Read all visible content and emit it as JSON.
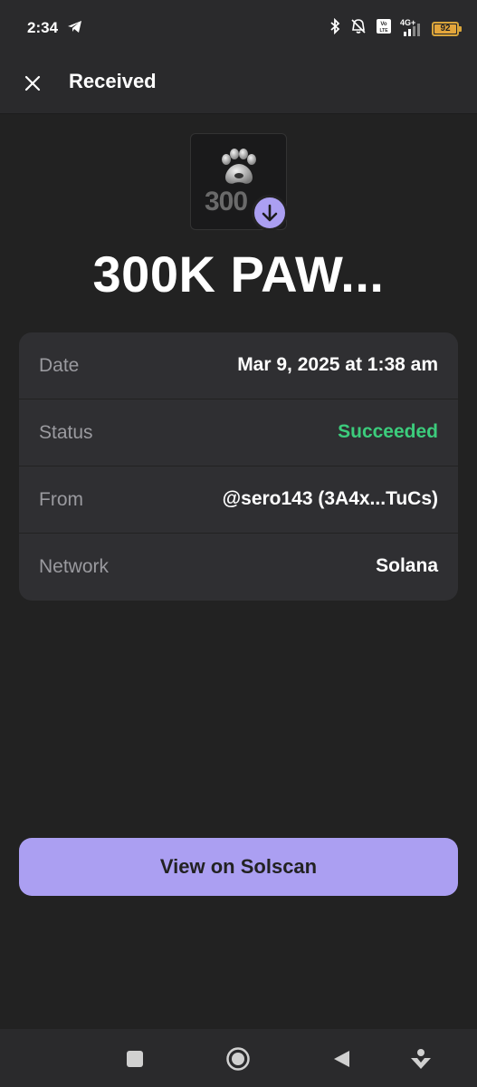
{
  "status_bar": {
    "time": "2:34",
    "battery": "92",
    "network": "4G+",
    "icons": [
      "telegram-icon",
      "bluetooth-icon",
      "mute-icon",
      "volte-icon",
      "signal-icon",
      "battery-icon"
    ]
  },
  "header": {
    "title": "Received",
    "close_icon": "close-icon"
  },
  "token": {
    "image_text": "300",
    "name": "300K PAW...",
    "badge_icon": "arrow-down-icon"
  },
  "details": [
    {
      "label": "Date",
      "value": "Mar 9, 2025 at 1:38 am"
    },
    {
      "label": "Status",
      "value": "Succeeded"
    },
    {
      "label": "From",
      "value": "@sero143 (3A4x...TuCs)"
    },
    {
      "label": "Network",
      "value": "Solana"
    }
  ],
  "actions": {
    "view_button": "View on Solscan"
  },
  "colors": {
    "accent": "#ab9ff2",
    "success": "#3ccc7c",
    "background": "#222222",
    "card": "#2f2f32"
  },
  "nav_bar": {
    "icons": [
      "recents-icon",
      "home-icon",
      "back-icon",
      "assistant-icon"
    ]
  }
}
